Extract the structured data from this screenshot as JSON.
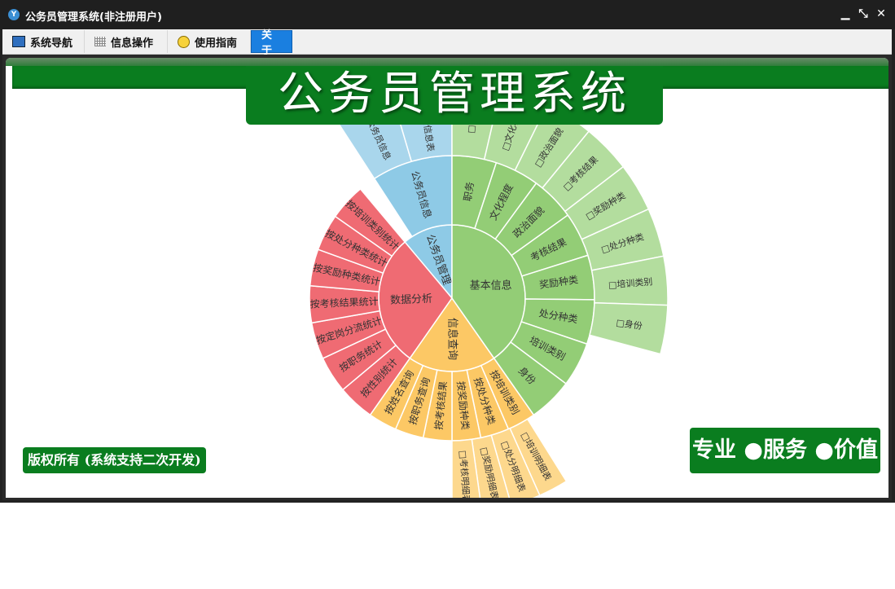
{
  "window": {
    "title": "公务员管理系统(非注册用户)",
    "controls": [
      "minimize",
      "restore",
      "close"
    ]
  },
  "menu": [
    {
      "label": "系统导航",
      "icon": "monitor-icon",
      "active": false
    },
    {
      "label": "信息操作",
      "icon": "grid-icon",
      "active": false
    },
    {
      "label": "使用指南",
      "icon": "lightbulb-icon",
      "active": false
    },
    {
      "label": "关于",
      "icon": "",
      "active": true
    }
  ],
  "banner": {
    "title": "公务员管理系统"
  },
  "copyright": "版权所有 (系统支持二次开发)",
  "slogan": "专业 ●服务 ●价值",
  "colors": {
    "green": "#0a7d1f",
    "blue": "#8ecae6",
    "red": "#ef6b73",
    "yellow": "#fcc865",
    "lightgreen": "#9ccf7e"
  },
  "sunburst": {
    "groups": [
      {
        "name": "公务员管理",
        "color": "#8ecae6",
        "light": "#a9d6ec",
        "ring2": [
          "公务员信息"
        ],
        "ring3": [
          "□公务员信息",
          "□公务员信息表"
        ]
      },
      {
        "name": "数据分析",
        "color": "#ef6b73",
        "light": "#f28c92",
        "ring2": [
          "按性别统计",
          "按职务统计",
          "按定岗分流统计",
          "按考核结果统计",
          "按奖励种类统计",
          "按处分种类统计",
          "按培训类别统计"
        ],
        "ring3": []
      },
      {
        "name": "信息查询",
        "color": "#fcc865",
        "light": "#fdd88d",
        "ring2": [
          "按培训类别",
          "按处分种类",
          "按奖励种类",
          "按考核结果",
          "按职务查询",
          "按姓名查询"
        ],
        "ring3": [
          "□培训明细表",
          "□处分明细表",
          "□奖励明细表",
          "□考核明细表"
        ]
      },
      {
        "name": "基本信息",
        "color": "#93cd76",
        "light": "#b3dd9e",
        "ring2": [
          "职务",
          "文化程度",
          "政治面貌",
          "考核结果",
          "奖励种类",
          "处分种类",
          "培训类别",
          "身份"
        ],
        "ring3": [
          "□职务",
          "□文化程度",
          "□政治面貌",
          "□考核结果",
          "□奖励种类",
          "□处分种类",
          "□培训类别",
          "□身份"
        ]
      }
    ]
  }
}
